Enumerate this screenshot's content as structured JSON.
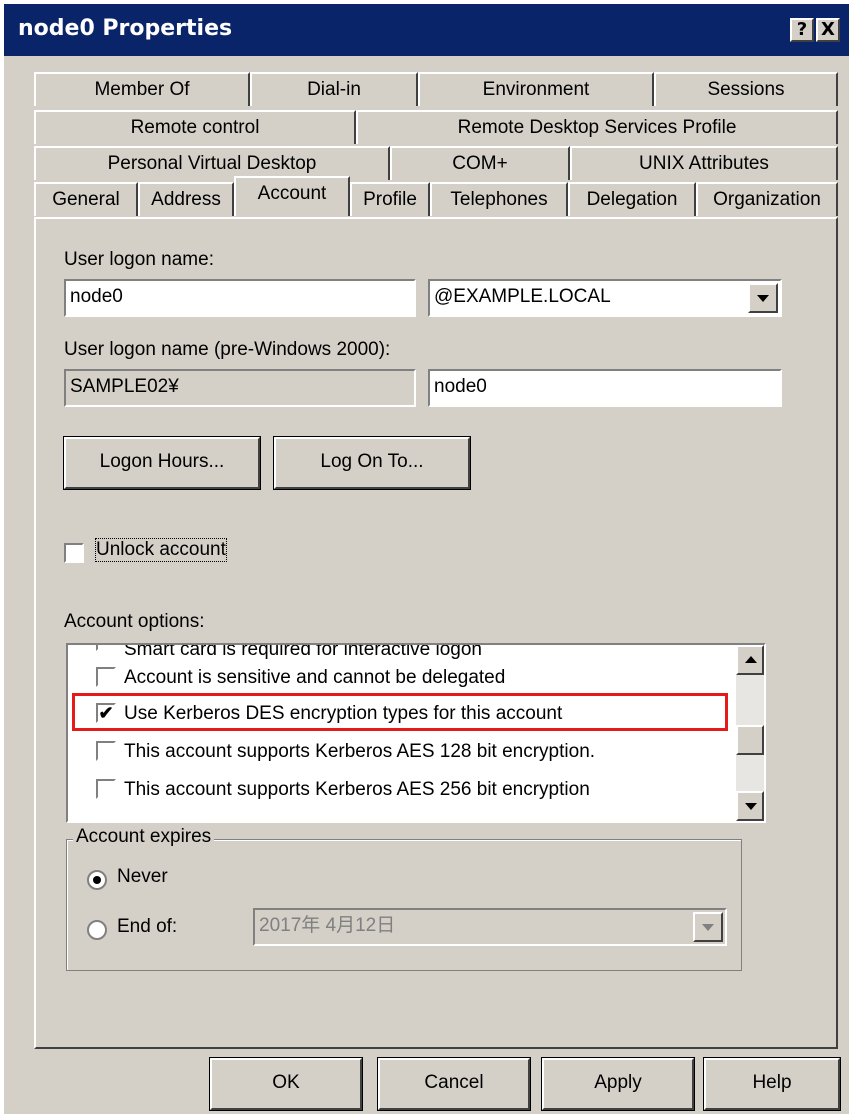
{
  "window": {
    "title": "node0 Properties",
    "help_glyph": "?",
    "close_glyph": "X"
  },
  "tabs": {
    "row1": [
      "Member Of",
      "Dial-in",
      "Environment",
      "Sessions"
    ],
    "row2": [
      "Remote control",
      "Remote Desktop Services Profile"
    ],
    "row3": [
      "Personal Virtual Desktop",
      "COM+",
      "UNIX Attributes"
    ],
    "row4": [
      "General",
      "Address",
      "Account",
      "Profile",
      "Telephones",
      "Delegation",
      "Organization"
    ],
    "selected": "Account"
  },
  "account": {
    "logon_name_label": "User logon name:",
    "logon_name_value": "node0",
    "domain_value": "@EXAMPLE.LOCAL",
    "pre2000_label": "User logon name (pre-Windows 2000):",
    "pre2000_domain": "SAMPLE02¥",
    "pre2000_name": "node0",
    "logon_hours_button": "Logon Hours...",
    "log_on_to_button": "Log On To...",
    "unlock_label": "Unlock account",
    "unlock_checked": false,
    "options_label": "Account options:",
    "options": [
      {
        "label": "Smart card is required for interactive logon",
        "checked": false
      },
      {
        "label": "Account is sensitive and cannot be delegated",
        "checked": false
      },
      {
        "label": "Use Kerberos DES encryption types for this account",
        "checked": true
      },
      {
        "label": "This account supports Kerberos AES 128 bit encryption.",
        "checked": false
      },
      {
        "label": "This account supports Kerberos AES 256 bit encryption",
        "checked": false
      }
    ],
    "highlight_color": "#e31b1b",
    "expires_label": "Account expires",
    "never_label": "Never",
    "end_of_label": "End of:",
    "expires_selection": "Never",
    "end_date": "2017年  4月12日"
  },
  "footer": {
    "ok": "OK",
    "cancel": "Cancel",
    "apply": "Apply",
    "help": "Help"
  },
  "check_glyph": "✔"
}
